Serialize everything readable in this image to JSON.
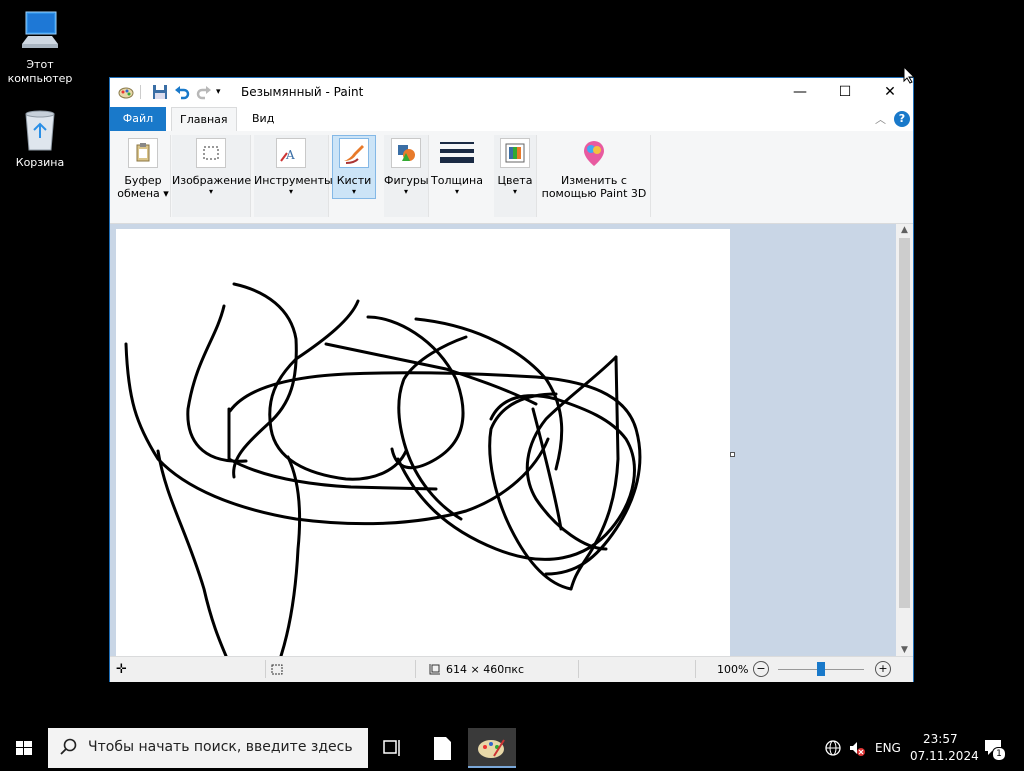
{
  "desktop": {
    "icons": [
      {
        "label_line1": "Этот",
        "label_line2": "компьютер",
        "icon": "computer-icon"
      },
      {
        "label_line1": "Корзина",
        "label_line2": "",
        "icon": "recycle-bin-icon"
      }
    ]
  },
  "window": {
    "title": "Безымянный - Paint",
    "controls": {
      "minimize": "—",
      "maximize": "☐",
      "close": "✕"
    },
    "tabs": {
      "file": "Файл",
      "home": "Главная",
      "view": "Вид"
    },
    "ribbon": {
      "groups": [
        {
          "line1": "Буфер",
          "line2": "обмена ▾",
          "icon": "clipboard-icon"
        },
        {
          "line1": "Изображение",
          "line2": "▾",
          "icon": "select-icon"
        },
        {
          "line1": "Инструменты",
          "line2": "▾",
          "icon": "tools-icon"
        },
        {
          "line1": "Кисти",
          "line2": "▾",
          "icon": "brush-icon"
        },
        {
          "line1": "Фигуры",
          "line2": "▾",
          "icon": "shapes-icon"
        },
        {
          "line1": "Толщина",
          "line2": "▾",
          "icon": "thickness-icon"
        },
        {
          "line1": "Цвета",
          "line2": "▾",
          "icon": "colors-icon"
        },
        {
          "line1": "Изменить с",
          "line2": "помощью Paint 3D",
          "icon": "paint3d-icon"
        }
      ]
    },
    "status": {
      "image_size": "614 × 460пкс",
      "zoom": "100%"
    }
  },
  "taskbar": {
    "search_placeholder": "Чтобы начать поиск, введите здесь",
    "language": "ENG",
    "time": "23:57",
    "date": "07.11.2024",
    "notifications": "1"
  },
  "colors": {
    "accent": "#1979ca",
    "canvas_bg": "#c9d6e6",
    "ribbon_bg": "#f5f6f7",
    "selected_tool": "#cce4f7"
  }
}
